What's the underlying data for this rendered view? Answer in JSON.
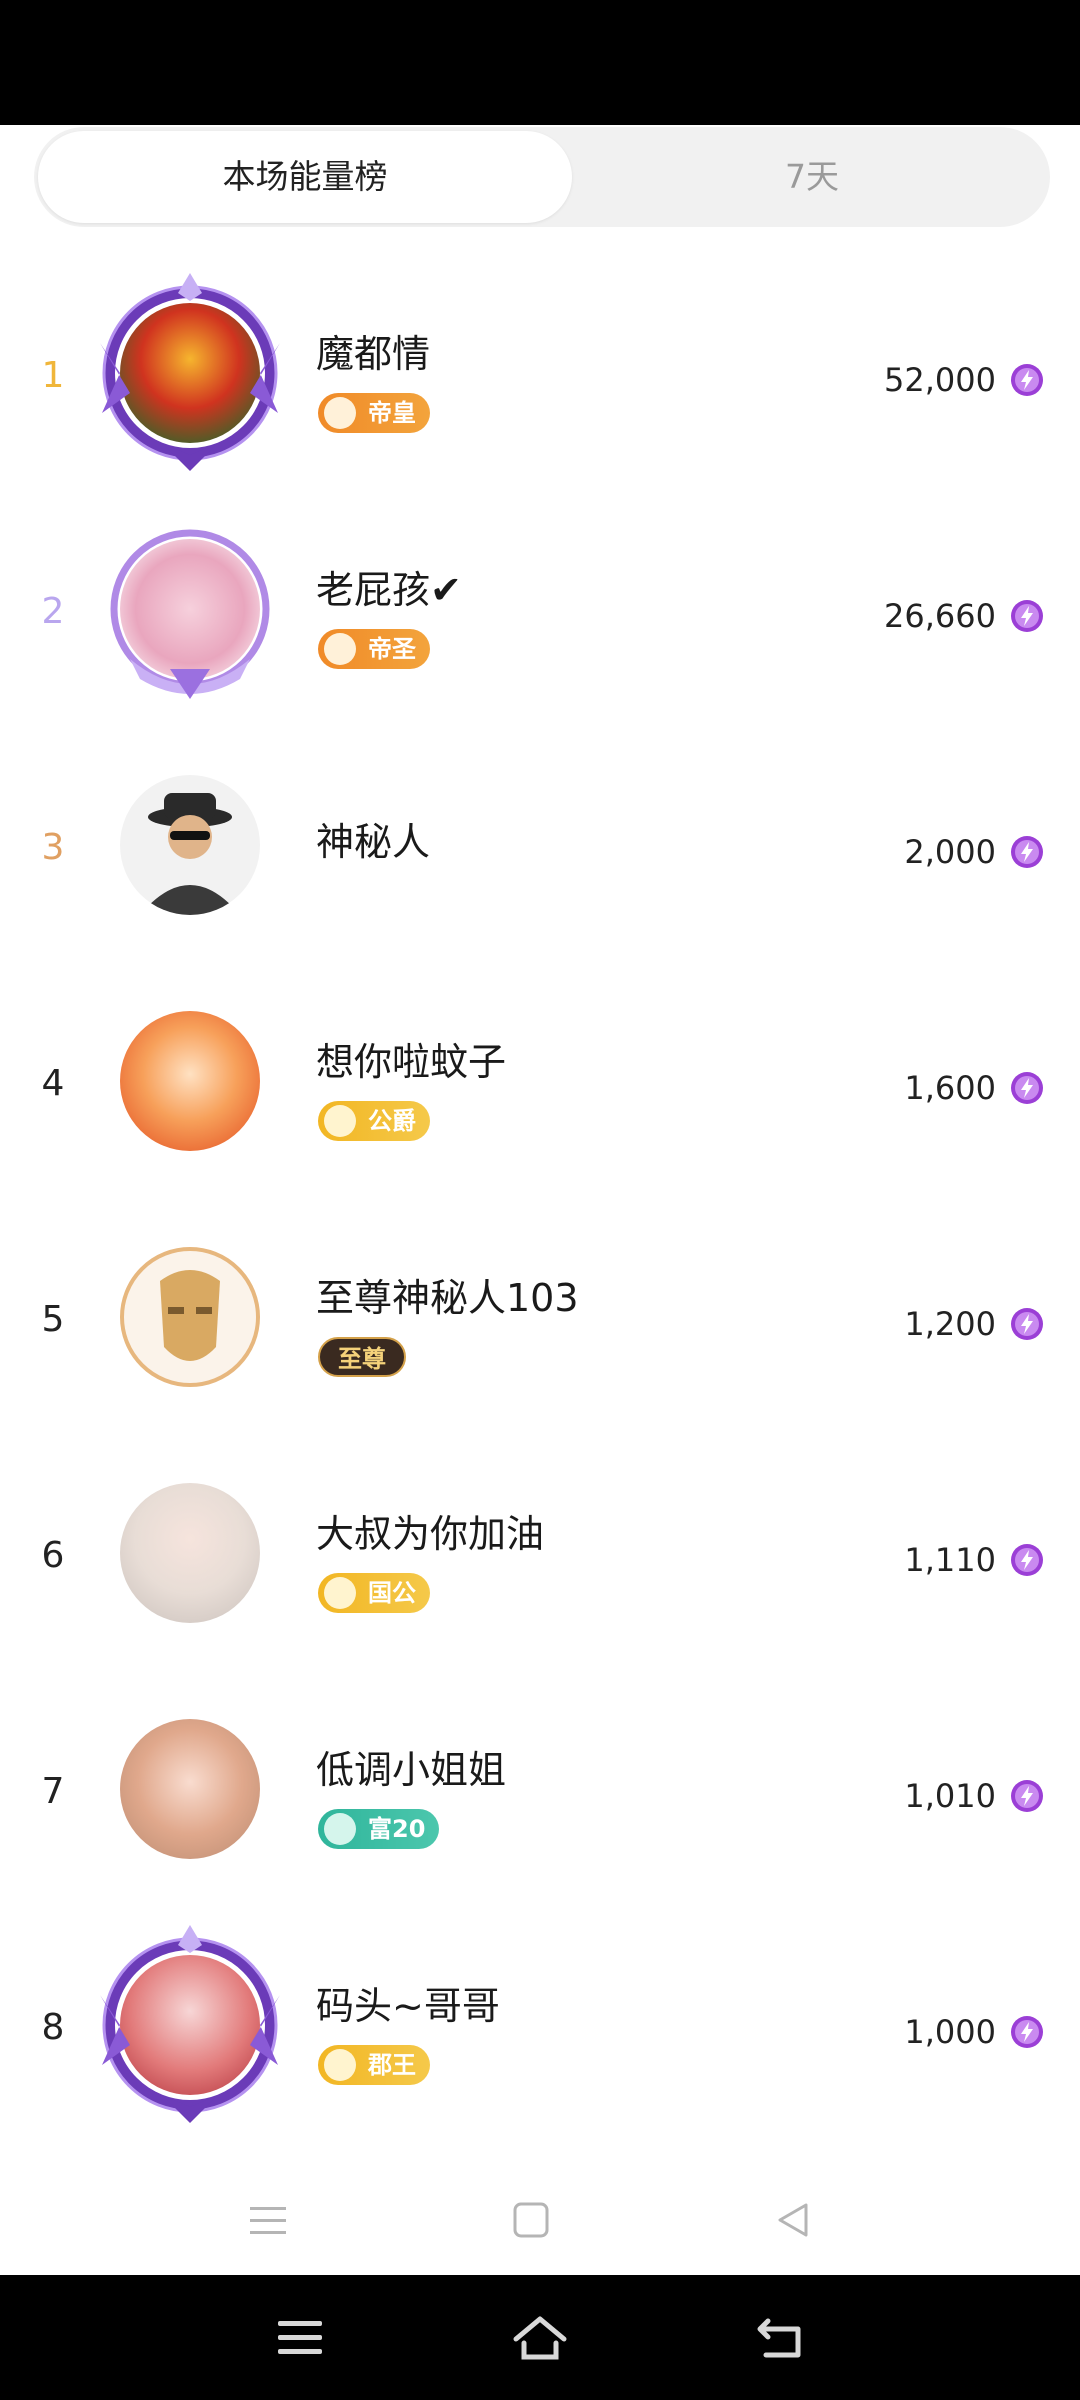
{
  "tabs": {
    "active": "本场能量榜",
    "inactive": "7天"
  },
  "colors": {
    "energy_icon": "#9b3fd6",
    "rank1": "#f0b63a",
    "rank2": "#b9a6ee",
    "rank3": "#e0a062"
  },
  "rows": [
    {
      "rank": "1",
      "name": "魔都情",
      "badge": "帝皇",
      "score": "52,000"
    },
    {
      "rank": "2",
      "name": "老屁孩✔",
      "badge": "帝圣",
      "score": "26,660"
    },
    {
      "rank": "3",
      "name": "神秘人",
      "badge": "",
      "score": "2,000"
    },
    {
      "rank": "4",
      "name": "想你啦蚊子",
      "badge": "公爵",
      "score": "1,600"
    },
    {
      "rank": "5",
      "name": "至尊神秘人103",
      "badge": "至尊",
      "score": "1,200"
    },
    {
      "rank": "6",
      "name": "大叔为你加油",
      "badge": "国公",
      "score": "1,110"
    },
    {
      "rank": "7",
      "name": "低调小姐姐",
      "badge": "富20",
      "score": "1,010"
    },
    {
      "rank": "8",
      "name": "码头~哥哥",
      "badge": "郡王",
      "score": "1,000"
    }
  ]
}
